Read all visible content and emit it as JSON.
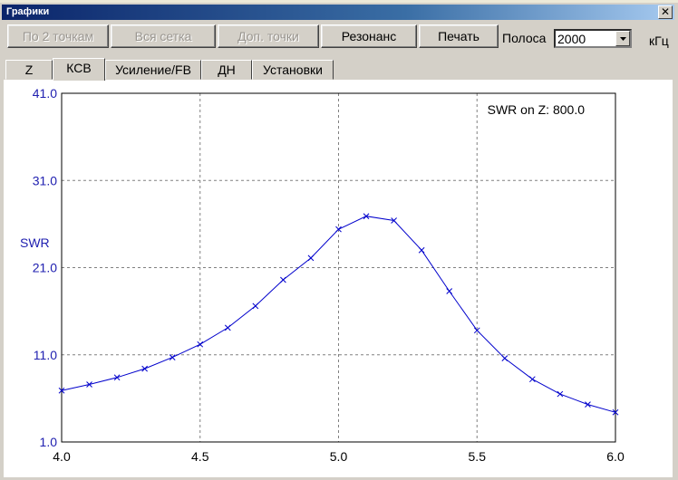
{
  "window": {
    "title": "Графики",
    "close_symbol": "✕"
  },
  "toolbar": {
    "buttons": [
      {
        "label": "По 2 точкам",
        "enabled": false
      },
      {
        "label": "Вся сетка",
        "enabled": false
      },
      {
        "label": "Доп. точки",
        "enabled": false
      },
      {
        "label": "Резонанс",
        "enabled": true
      },
      {
        "label": "Печать",
        "enabled": true
      }
    ],
    "band_label": "Полоса",
    "band_value": "2000",
    "unit": "кГц"
  },
  "tabs": [
    {
      "label": "Z",
      "active": false
    },
    {
      "label": "КСВ",
      "active": true
    },
    {
      "label": "Усиление/FB",
      "active": false
    },
    {
      "label": "ДН",
      "active": false
    },
    {
      "label": "Установки",
      "active": false
    }
  ],
  "chart_data": {
    "type": "line",
    "ylabel": "SWR",
    "annotation": "SWR on Z: 800.0",
    "xlim": [
      4.0,
      6.0
    ],
    "ylim": [
      1.0,
      41.0
    ],
    "x_ticks": [
      "4.0",
      "4.5",
      "5.0",
      "5.5",
      "6.0"
    ],
    "y_ticks": [
      "41.0",
      "31.0",
      "21.0",
      "11.0",
      "1.0"
    ],
    "grid": true,
    "colors": {
      "line": "#0000cc",
      "axis_text": "#2020b0",
      "grid": "#808080"
    },
    "series": [
      {
        "x": [
          4.0,
          4.1,
          4.2,
          4.3,
          4.4,
          4.5,
          4.6,
          4.7,
          4.8,
          4.9,
          5.0,
          5.1,
          5.2,
          5.3,
          5.4,
          5.5,
          5.6,
          5.7,
          5.8,
          5.9,
          6.0
        ],
        "y": [
          6.9,
          7.6,
          8.4,
          9.4,
          10.7,
          12.2,
          14.1,
          16.6,
          19.6,
          22.1,
          25.4,
          26.9,
          26.4,
          23.0,
          18.3,
          13.8,
          10.6,
          8.2,
          6.5,
          5.3,
          4.4
        ]
      }
    ]
  }
}
